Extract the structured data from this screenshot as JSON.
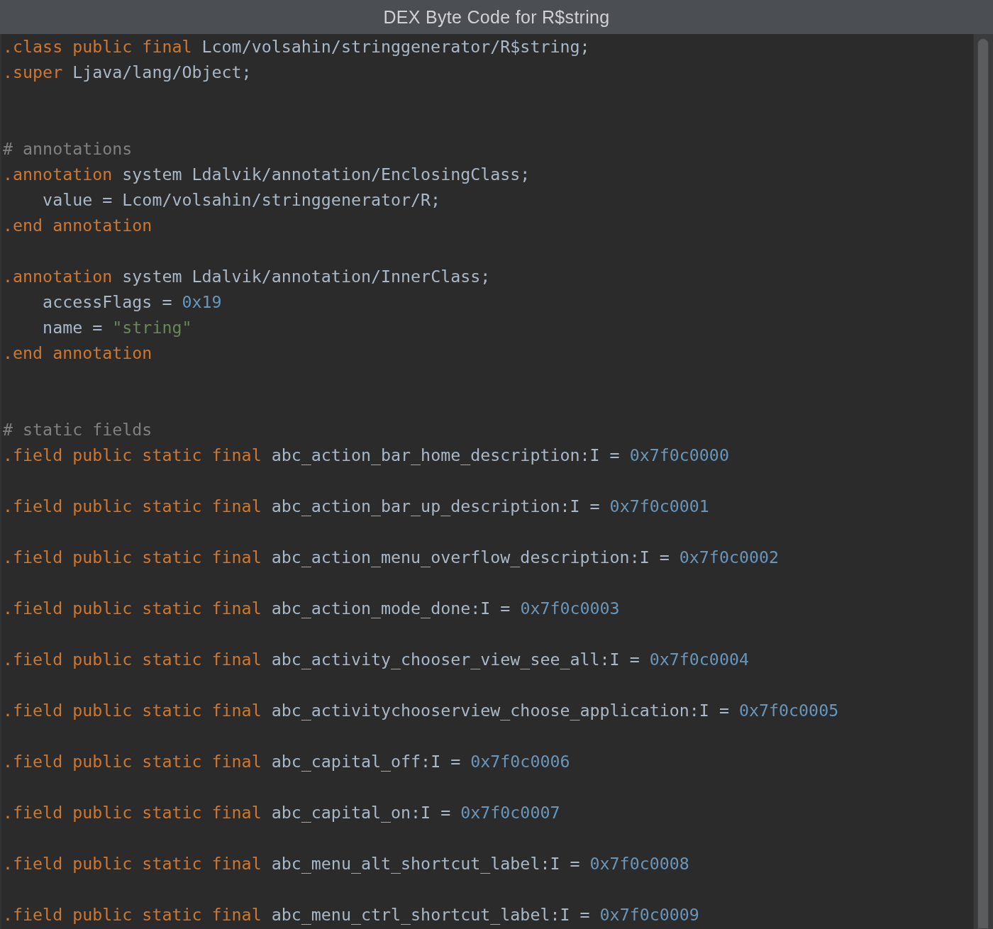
{
  "window": {
    "title": "DEX Byte Code for R$string"
  },
  "editor": {
    "lines": [
      {
        "kind": "code",
        "tokens": [
          {
            "kind": "keyword",
            "text": ".class public final"
          },
          {
            "kind": "plain",
            "text": " Lcom/volsahin/stringgenerator/R$string;"
          }
        ]
      },
      {
        "kind": "code",
        "tokens": [
          {
            "kind": "keyword",
            "text": ".super"
          },
          {
            "kind": "plain",
            "text": " Ljava/lang/Object;"
          }
        ]
      },
      {
        "kind": "blank"
      },
      {
        "kind": "blank"
      },
      {
        "kind": "code",
        "tokens": [
          {
            "kind": "comment",
            "text": "# annotations"
          }
        ]
      },
      {
        "kind": "code",
        "tokens": [
          {
            "kind": "keyword",
            "text": ".annotation"
          },
          {
            "kind": "plain",
            "text": " system Ldalvik/annotation/EnclosingClass;"
          }
        ]
      },
      {
        "kind": "code",
        "tokens": [
          {
            "kind": "plain",
            "text": "    value = Lcom/volsahin/stringgenerator/R;"
          }
        ]
      },
      {
        "kind": "code",
        "tokens": [
          {
            "kind": "keyword",
            "text": ".end annotation"
          }
        ]
      },
      {
        "kind": "blank"
      },
      {
        "kind": "code",
        "tokens": [
          {
            "kind": "keyword",
            "text": ".annotation"
          },
          {
            "kind": "plain",
            "text": " system Ldalvik/annotation/InnerClass;"
          }
        ]
      },
      {
        "kind": "code",
        "tokens": [
          {
            "kind": "plain",
            "text": "    accessFlags = "
          },
          {
            "kind": "number",
            "text": "0x19"
          }
        ]
      },
      {
        "kind": "code",
        "tokens": [
          {
            "kind": "plain",
            "text": "    name = "
          },
          {
            "kind": "string",
            "text": "\"string\""
          }
        ]
      },
      {
        "kind": "code",
        "tokens": [
          {
            "kind": "keyword",
            "text": ".end annotation"
          }
        ]
      },
      {
        "kind": "blank"
      },
      {
        "kind": "blank"
      },
      {
        "kind": "code",
        "tokens": [
          {
            "kind": "comment",
            "text": "# static fields"
          }
        ]
      },
      {
        "kind": "code",
        "tokens": [
          {
            "kind": "keyword",
            "text": ".field public static final"
          },
          {
            "kind": "plain",
            "text": " abc_action_bar_home_description:I = "
          },
          {
            "kind": "number",
            "text": "0x7f0c0000"
          }
        ]
      },
      {
        "kind": "blank"
      },
      {
        "kind": "code",
        "tokens": [
          {
            "kind": "keyword",
            "text": ".field public static final"
          },
          {
            "kind": "plain",
            "text": " abc_action_bar_up_description:I = "
          },
          {
            "kind": "number",
            "text": "0x7f0c0001"
          }
        ]
      },
      {
        "kind": "blank"
      },
      {
        "kind": "code",
        "tokens": [
          {
            "kind": "keyword",
            "text": ".field public static final"
          },
          {
            "kind": "plain",
            "text": " abc_action_menu_overflow_description:I = "
          },
          {
            "kind": "number",
            "text": "0x7f0c0002"
          }
        ]
      },
      {
        "kind": "blank"
      },
      {
        "kind": "code",
        "tokens": [
          {
            "kind": "keyword",
            "text": ".field public static final"
          },
          {
            "kind": "plain",
            "text": " abc_action_mode_done:I = "
          },
          {
            "kind": "number",
            "text": "0x7f0c0003"
          }
        ]
      },
      {
        "kind": "blank"
      },
      {
        "kind": "code",
        "tokens": [
          {
            "kind": "keyword",
            "text": ".field public static final"
          },
          {
            "kind": "plain",
            "text": " abc_activity_chooser_view_see_all:I = "
          },
          {
            "kind": "number",
            "text": "0x7f0c0004"
          }
        ]
      },
      {
        "kind": "blank"
      },
      {
        "kind": "code",
        "tokens": [
          {
            "kind": "keyword",
            "text": ".field public static final"
          },
          {
            "kind": "plain",
            "text": " abc_activitychooserview_choose_application:I = "
          },
          {
            "kind": "number",
            "text": "0x7f0c0005"
          }
        ]
      },
      {
        "kind": "blank"
      },
      {
        "kind": "code",
        "tokens": [
          {
            "kind": "keyword",
            "text": ".field public static final"
          },
          {
            "kind": "plain",
            "text": " abc_capital_off:I = "
          },
          {
            "kind": "number",
            "text": "0x7f0c0006"
          }
        ]
      },
      {
        "kind": "blank"
      },
      {
        "kind": "code",
        "tokens": [
          {
            "kind": "keyword",
            "text": ".field public static final"
          },
          {
            "kind": "plain",
            "text": " abc_capital_on:I = "
          },
          {
            "kind": "number",
            "text": "0x7f0c0007"
          }
        ]
      },
      {
        "kind": "blank"
      },
      {
        "kind": "code",
        "tokens": [
          {
            "kind": "keyword",
            "text": ".field public static final"
          },
          {
            "kind": "plain",
            "text": " abc_menu_alt_shortcut_label:I = "
          },
          {
            "kind": "number",
            "text": "0x7f0c0008"
          }
        ]
      },
      {
        "kind": "blank"
      },
      {
        "kind": "code",
        "tokens": [
          {
            "kind": "keyword",
            "text": ".field public static final"
          },
          {
            "kind": "plain",
            "text": " abc_menu_ctrl_shortcut_label:I = "
          },
          {
            "kind": "number",
            "text": "0x7f0c0009"
          }
        ]
      }
    ]
  }
}
